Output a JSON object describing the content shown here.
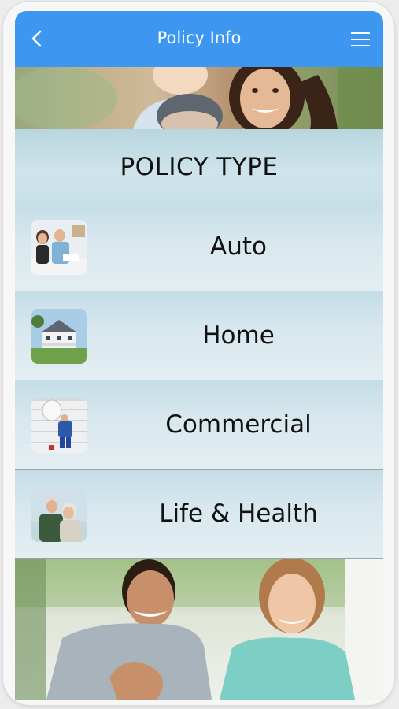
{
  "header": {
    "title": "Policy Info",
    "back_icon": "chevron-left-icon",
    "menu_icon": "hamburger-menu-icon",
    "color": "#3d97f0"
  },
  "section": {
    "title": "POLICY TYPE"
  },
  "policies": [
    {
      "label": "Auto",
      "icon": "business-meeting-thumbnail"
    },
    {
      "label": "Home",
      "icon": "house-thumbnail"
    },
    {
      "label": "Commercial",
      "icon": "satellite-technician-thumbnail"
    },
    {
      "label": "Life & Health",
      "icon": "elderly-couple-thumbnail"
    }
  ]
}
